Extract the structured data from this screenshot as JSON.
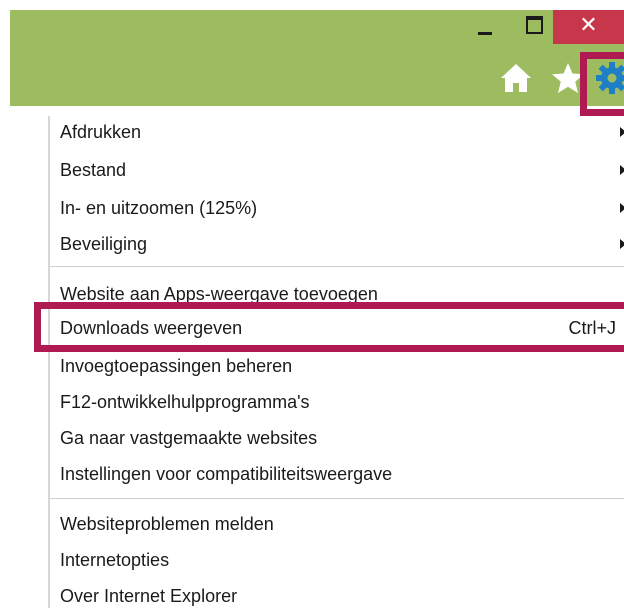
{
  "window": {
    "close_glyph": "✕"
  },
  "toolbar": {
    "icons": [
      "home-icon",
      "star-icon",
      "gear-icon"
    ]
  },
  "menu": {
    "group1": [
      {
        "label": "Afdrukken",
        "submenu": true
      },
      {
        "label": "Bestand",
        "submenu": true
      },
      {
        "label": "In- en uitzoomen (125%)",
        "submenu": true
      },
      {
        "label": "Beveiliging",
        "submenu": true
      }
    ],
    "group2": [
      {
        "label": "Website aan Apps-weergave toevoegen"
      },
      {
        "label": "Downloads weergeven",
        "shortcut": "Ctrl+J"
      },
      {
        "label": "Invoegtoepassingen beheren"
      },
      {
        "label": "F12-ontwikkelhulpprogramma's"
      },
      {
        "label": "Ga naar vastgemaakte websites"
      },
      {
        "label": "Instellingen voor compatibiliteitsweergave"
      }
    ],
    "group3": [
      {
        "label": "Websiteproblemen melden"
      },
      {
        "label": "Internetopties"
      },
      {
        "label": "Over Internet Explorer"
      }
    ]
  },
  "colors": {
    "titlebar": "#9dbc60",
    "close_button": "#c7374b",
    "highlight": "#b01a52",
    "gear": "#1f7fc4"
  }
}
